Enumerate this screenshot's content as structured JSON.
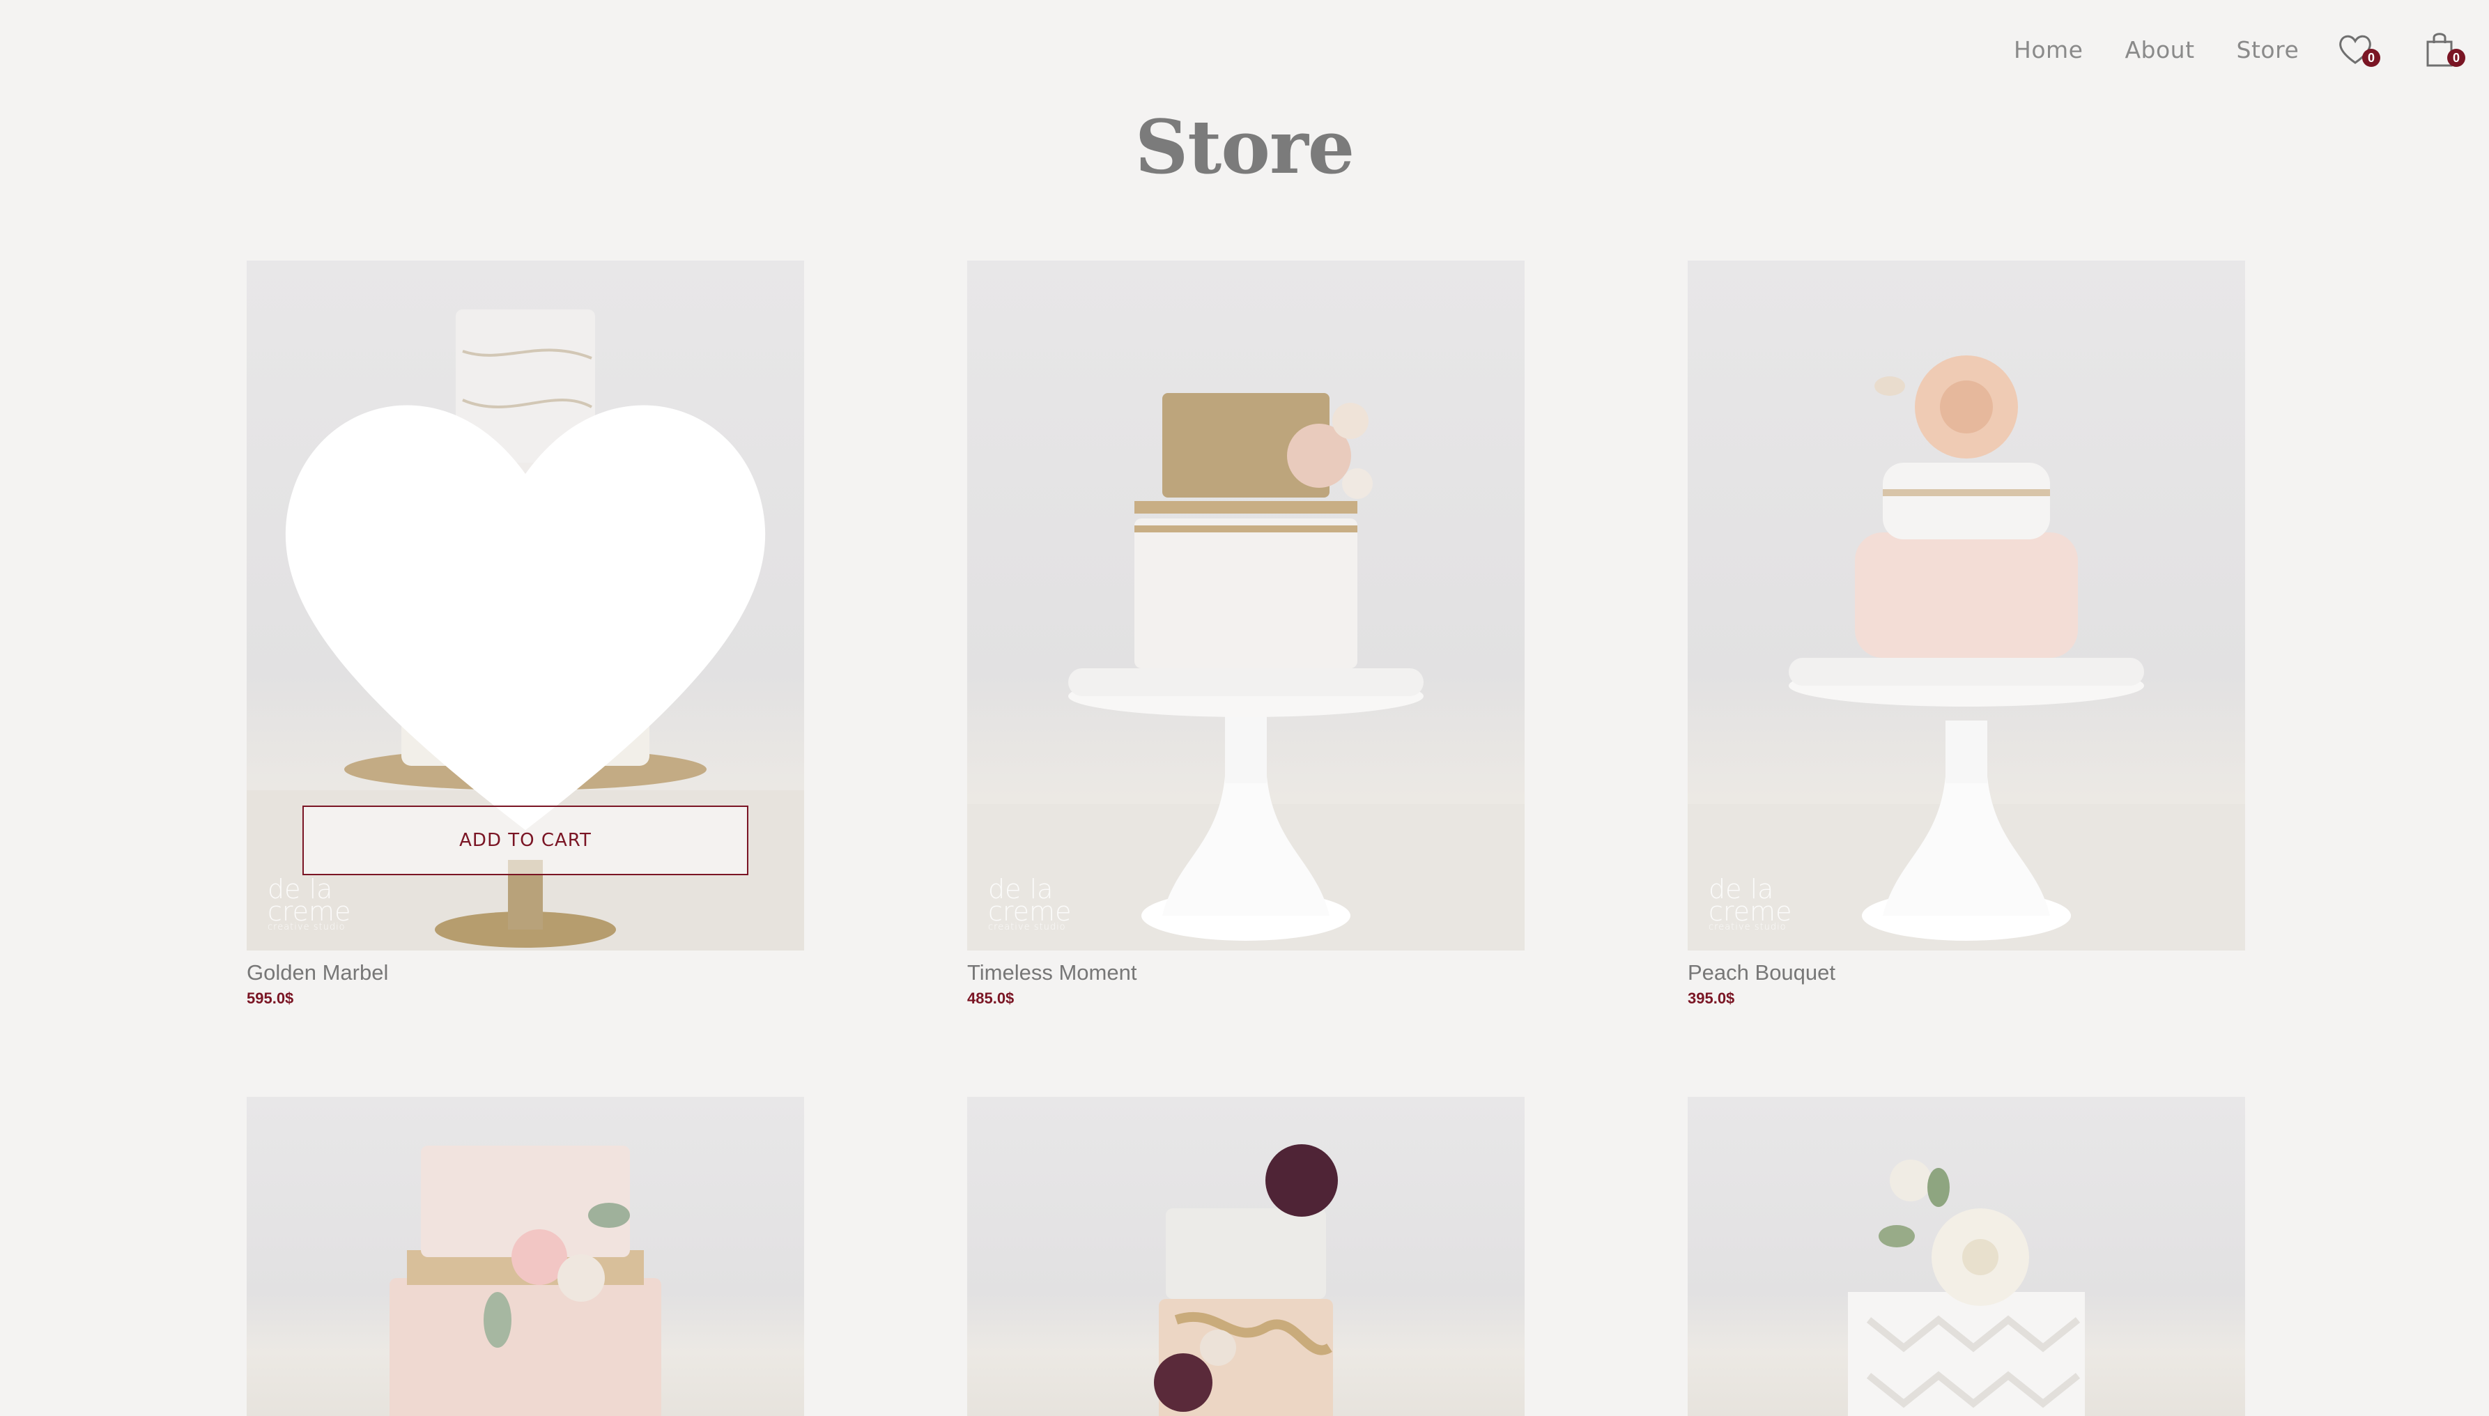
{
  "nav": {
    "home": "Home",
    "about": "About",
    "store": "Store"
  },
  "header": {
    "wishlist_count": "0",
    "cart_count": "0",
    "wishlist_icon": "heart-outline-icon",
    "cart_icon": "shopping-bag-icon"
  },
  "page": {
    "title": "Store"
  },
  "watermark": {
    "line1": "de la",
    "line2": "creme",
    "line3": "creative studio"
  },
  "products": [
    {
      "name": "Golden Marbel",
      "price": "595.0$",
      "add_to_cart": "ADD TO CART"
    },
    {
      "name": "Timeless Moment",
      "price": "485.0$"
    },
    {
      "name": "Peach Bouquet",
      "price": "395.0$"
    },
    {
      "name": "",
      "price": ""
    },
    {
      "name": "",
      "price": ""
    },
    {
      "name": "",
      "price": ""
    }
  ],
  "colors": {
    "accent": "#7a1524",
    "background": "#f4f3f2",
    "text": "#7a7a7a"
  }
}
